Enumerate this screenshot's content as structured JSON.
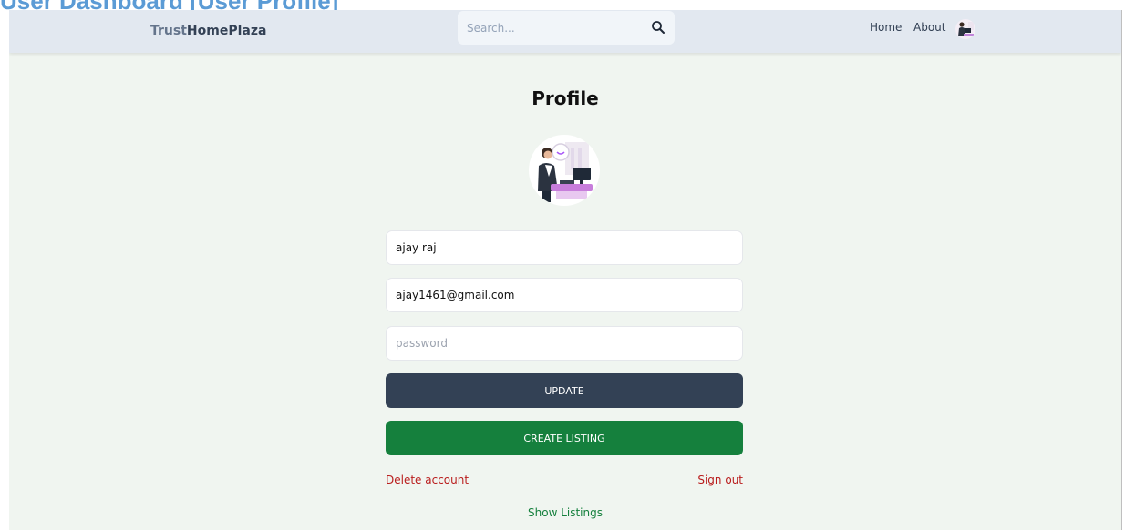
{
  "caption": "User Dashboard [User Profile]",
  "navbar": {
    "brand_part1": "Trust",
    "brand_part2": "HomePlaza",
    "search_placeholder": "Search...",
    "search_icon": "search-icon",
    "links": {
      "home": "Home",
      "about": "About"
    },
    "avatar": "user-avatar"
  },
  "profile": {
    "title": "Profile",
    "username_value": "ajay raj",
    "email_value": "ajay1461@gmail.com",
    "password_placeholder": "password",
    "update_label": "UPDATE",
    "create_listing_label": "CREATE LISTING",
    "delete_account_label": "Delete account",
    "sign_out_label": "Sign out",
    "show_listings_label": "Show Listings"
  },
  "colors": {
    "navbar_bg": "#e2e8f0",
    "page_bg": "#f0f5f0",
    "update_bg": "#334155",
    "create_bg": "#15803d",
    "danger": "#b91c1c",
    "success": "#15803d",
    "caption": "#5b9bd5"
  }
}
